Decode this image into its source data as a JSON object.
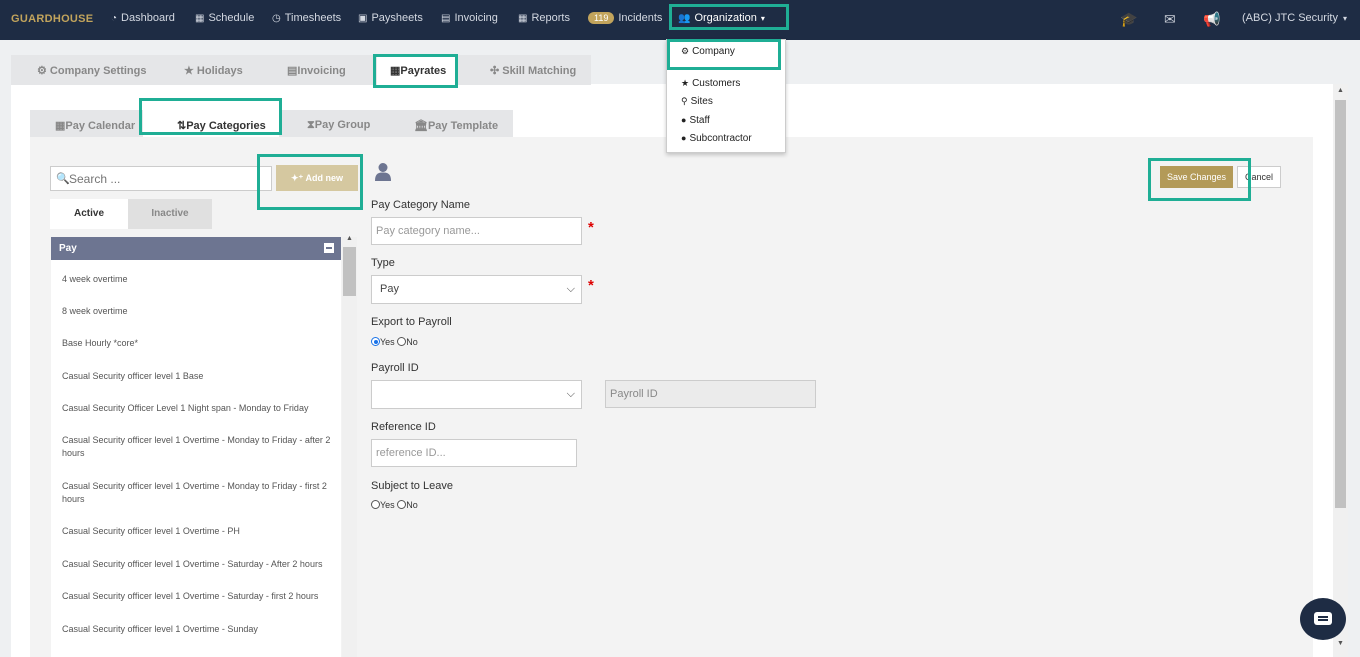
{
  "nav": {
    "brand": "GUARDHOUSE",
    "items": [
      "Dashboard",
      "Schedule",
      "Timesheets",
      "Paysheets",
      "Invoicing",
      "Reports",
      "Incidents",
      "Organization"
    ],
    "incidents_badge": "119",
    "account": "(ABC) JTC Security"
  },
  "org_menu": [
    "Company",
    "Customers",
    "Sites",
    "Staff",
    "Subcontractor"
  ],
  "top_tabs": [
    "Company Settings",
    "Holidays",
    "Invoicing",
    "Payrates",
    "Skill Matching"
  ],
  "sub_tabs": [
    "Pay Calendar",
    "Pay Categories",
    "Pay Group",
    "Pay Template"
  ],
  "left": {
    "search_placeholder": "Search ...",
    "add_new": "Add new",
    "filter_tabs": [
      "Active",
      "Inactive"
    ],
    "group_title": "Pay",
    "items": [
      "4 week overtime",
      "8 week overtime",
      "Base Hourly *core*",
      "Casual Security officer level 1 Base",
      "Casual Security Officer Level 1 Night span - Monday to Friday",
      "Casual Security officer level 1 Overtime - Monday to Friday - after 2 hours",
      "Casual Security officer level 1 Overtime - Monday to Friday - first 2 hours",
      "Casual Security officer level 1 Overtime - PH",
      "Casual Security officer level 1 Overtime - Saturday - After 2 hours",
      "Casual Security officer level 1 Overtime - Saturday - first 2 hours",
      "Casual Security officer level 1 Overtime - Sunday"
    ]
  },
  "form": {
    "name_label": "Pay Category Name",
    "name_placeholder": "Pay category name...",
    "type_label": "Type",
    "type_value": "Pay",
    "export_label": "Export to Payroll",
    "yes": "Yes",
    "no": "No",
    "payroll_id_label": "Payroll ID",
    "payroll_id_placeholder": "Payroll ID",
    "reference_label": "Reference ID",
    "reference_placeholder": "reference ID...",
    "leave_label": "Subject to Leave",
    "required_mark": "*"
  },
  "actions": {
    "save": "Save Changes",
    "cancel": "Cancel"
  }
}
